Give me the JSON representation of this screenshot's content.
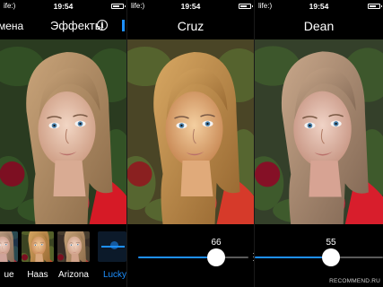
{
  "status_bar": {
    "carrier": "life:)",
    "time": "19:54",
    "carrier_partial_left": "ife:)"
  },
  "panels": [
    {
      "nav": {
        "cancel_label": "мена",
        "title": "Эффекты"
      },
      "filters": [
        {
          "label": "ue",
          "selected": false
        },
        {
          "label": "Haas",
          "selected": false
        },
        {
          "label": "Arizona",
          "selected": false
        },
        {
          "label": "Lucky",
          "selected": true
        }
      ]
    },
    {
      "nav": {
        "title": "Cruz"
      },
      "slider": {
        "value": "66",
        "fraction": 0.66
      }
    },
    {
      "nav": {
        "title": "Dean"
      },
      "slider": {
        "value": "55",
        "fraction": 0.55
      }
    }
  ],
  "watermark": "RECOMMEND.RU",
  "colors": {
    "accent": "#1e90ff",
    "background": "#000000"
  },
  "icons": {
    "info": "info-icon",
    "battery": "battery-icon",
    "wifi": "wifi-icon"
  }
}
